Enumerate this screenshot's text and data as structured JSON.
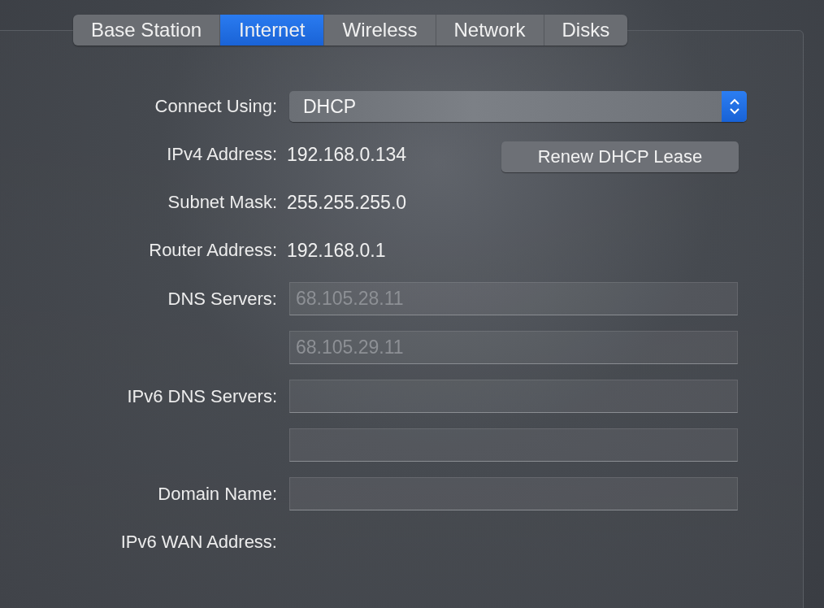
{
  "tabs": [
    {
      "label": "Base Station",
      "selected": false
    },
    {
      "label": "Internet",
      "selected": true
    },
    {
      "label": "Wireless",
      "selected": false
    },
    {
      "label": "Network",
      "selected": false
    },
    {
      "label": "Disks",
      "selected": false
    }
  ],
  "rows": [
    {
      "kind": "popup",
      "label": "Connect Using:",
      "value": "DHCP"
    },
    {
      "kind": "text",
      "label": "IPv4 Address:",
      "value": "192.168.0.134",
      "button": "Renew DHCP Lease"
    },
    {
      "kind": "text",
      "label": "Subnet Mask:",
      "value": "255.255.255.0"
    },
    {
      "kind": "text",
      "label": "Router Address:",
      "value": "192.168.0.1"
    },
    {
      "kind": "field",
      "label": "DNS Servers:",
      "placeholder": "68.105.28.11"
    },
    {
      "kind": "field",
      "placeholder": "68.105.29.11"
    },
    {
      "kind": "field",
      "label": "IPv6 DNS Servers:"
    },
    {
      "kind": "field"
    },
    {
      "kind": "field",
      "label": "Domain Name:"
    },
    {
      "kind": "text",
      "label": "IPv6 WAN Address:"
    }
  ]
}
